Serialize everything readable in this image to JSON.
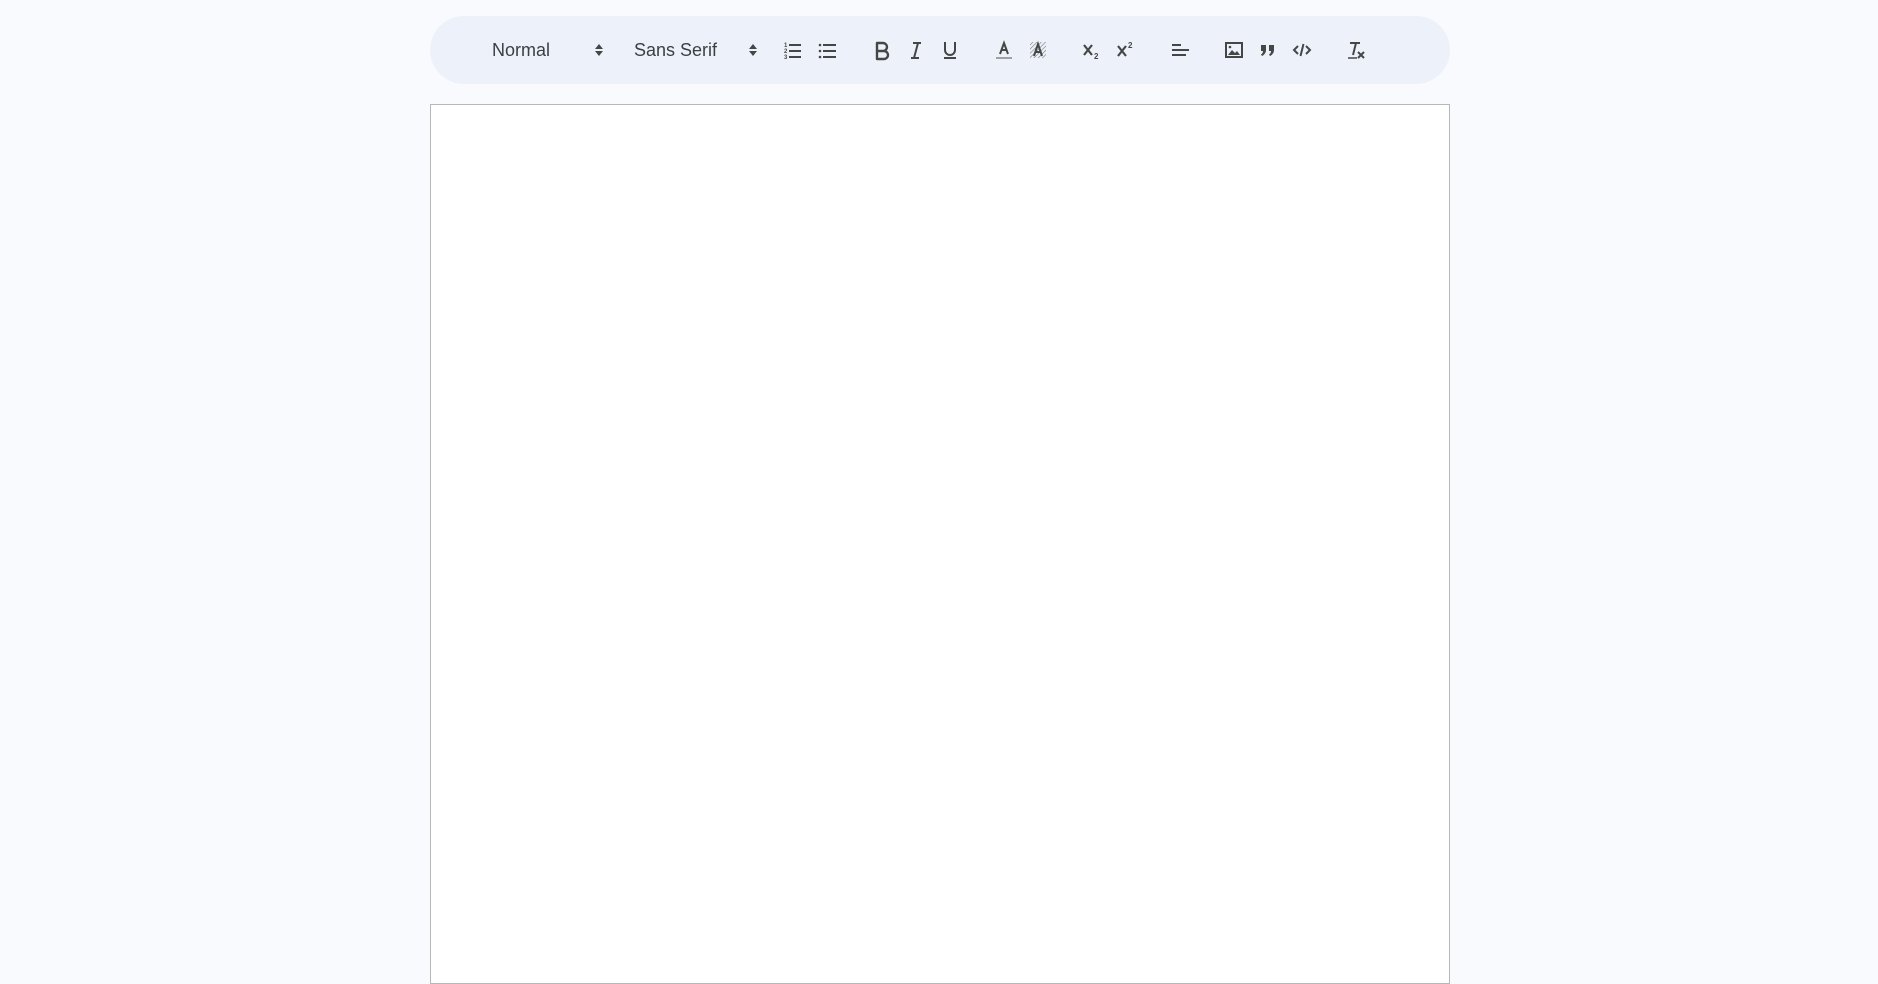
{
  "toolbar": {
    "header_picker": {
      "selected": "Normal",
      "icon": "up-down-arrows-icon"
    },
    "font_picker": {
      "selected": "Sans Serif",
      "icon": "up-down-arrows-icon"
    },
    "buttons": [
      {
        "name": "ordered-list",
        "icon": "ordered-list-icon"
      },
      {
        "name": "bullet-list",
        "icon": "bullet-list-icon"
      },
      {
        "name": "bold",
        "icon": "bold-icon"
      },
      {
        "name": "italic",
        "icon": "italic-icon"
      },
      {
        "name": "underline",
        "icon": "underline-icon"
      },
      {
        "name": "text-color",
        "icon": "text-color-icon"
      },
      {
        "name": "background-color",
        "icon": "background-color-icon"
      },
      {
        "name": "subscript",
        "icon": "subscript-icon"
      },
      {
        "name": "superscript",
        "icon": "superscript-icon"
      },
      {
        "name": "align",
        "icon": "align-left-icon"
      },
      {
        "name": "image",
        "icon": "image-icon"
      },
      {
        "name": "blockquote",
        "icon": "blockquote-icon"
      },
      {
        "name": "code-block",
        "icon": "code-icon"
      },
      {
        "name": "clear-formatting",
        "icon": "clear-formatting-icon"
      }
    ]
  },
  "editor": {
    "content": ""
  },
  "colors": {
    "page_background": "#f8fafd",
    "toolbar_background": "#edf2fa",
    "editor_background": "#ffffff",
    "editor_border": "#b8b8b8",
    "icon_color": "#444746"
  }
}
